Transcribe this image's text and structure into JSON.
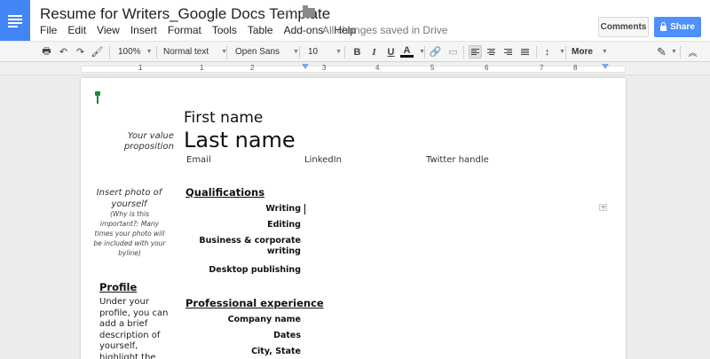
{
  "app": {
    "doc_title": "Resume for Writers_Google Docs Template",
    "saved_status": "All changes saved in Drive",
    "menu": [
      "File",
      "Edit",
      "View",
      "Insert",
      "Format",
      "Tools",
      "Table",
      "Add-ons",
      "Help"
    ],
    "comments_label": "Comments",
    "share_label": "Share"
  },
  "toolbar": {
    "zoom": "100%",
    "style": "Normal text",
    "font": "Open Sans",
    "size": "10",
    "bold": "B",
    "italic": "I",
    "underline": "U",
    "text_color": "A",
    "more": "More"
  },
  "ruler": {
    "numbers": [
      "1",
      "1",
      "2",
      "3",
      "4",
      "5",
      "6",
      "7",
      "8"
    ]
  },
  "document": {
    "first_name": "First name",
    "last_name": "Last name",
    "contact": {
      "email": "Email",
      "linkedin": "LinkedIn",
      "twitter": "Twitter handle"
    },
    "value_prop": "Your value proposition",
    "photo_title": "Insert photo of yourself",
    "photo_note": "(Why is this important?: Many times your photo will be included with your byline)",
    "qualifications": {
      "heading": "Qualifications",
      "items": [
        "Writing",
        "Editing",
        "Business & corporate writing",
        "Desktop publishing"
      ]
    },
    "profile": {
      "heading": "Profile",
      "text": "Under your profile, you can add a brief description of yourself, highlight the"
    },
    "experience": {
      "heading": "Professional experience",
      "items": [
        "Company name",
        "Dates",
        "City, State"
      ]
    }
  },
  "colors": {
    "brand_blue": "#4285f4",
    "share_blue": "#4d90fe",
    "cursor_green": "#1a8a3a"
  }
}
